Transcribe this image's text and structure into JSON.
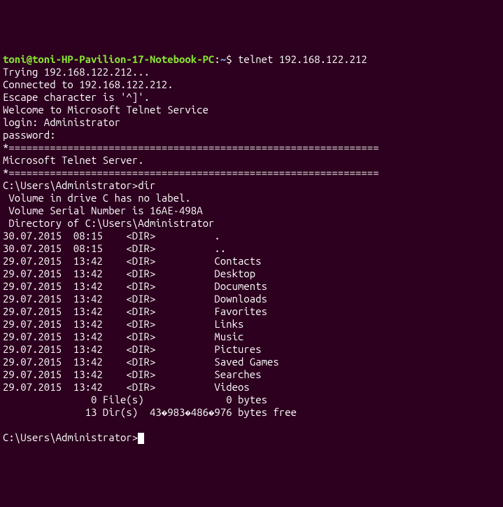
{
  "prompt": {
    "user_host": "toni@toni-HP-Pavilion-17-Notebook-PC",
    "colon": ":",
    "path": "~",
    "dollar": "$ ",
    "command": "telnet 192.168.122.212"
  },
  "output": {
    "l1": "Trying 192.168.122.212...",
    "l2": "Connected to 192.168.122.212.",
    "l3": "Escape character is '^]'.",
    "l4": "Welcome to Microsoft Telnet Service ",
    "l5": "",
    "l6": "login: Administrator",
    "l7": "password: ",
    "l8": "",
    "l9": "*===============================================================",
    "l10": "Microsoft Telnet Server.",
    "l11": "*===============================================================",
    "l12": "C:\\Users\\Administrator>dir",
    "l13": " Volume in drive C has no label.",
    "l14": " Volume Serial Number is 16AE-498A",
    "l15": "",
    "l16": " Directory of C:\\Users\\Administrator",
    "l17": ""
  },
  "dir_listing": [
    {
      "date": "30.07.2015",
      "time": "08:15",
      "type": "<DIR>",
      "name": "."
    },
    {
      "date": "30.07.2015",
      "time": "08:15",
      "type": "<DIR>",
      "name": ".."
    },
    {
      "date": "29.07.2015",
      "time": "13:42",
      "type": "<DIR>",
      "name": "Contacts"
    },
    {
      "date": "29.07.2015",
      "time": "13:42",
      "type": "<DIR>",
      "name": "Desktop"
    },
    {
      "date": "29.07.2015",
      "time": "13:42",
      "type": "<DIR>",
      "name": "Documents"
    },
    {
      "date": "29.07.2015",
      "time": "13:42",
      "type": "<DIR>",
      "name": "Downloads"
    },
    {
      "date": "29.07.2015",
      "time": "13:42",
      "type": "<DIR>",
      "name": "Favorites"
    },
    {
      "date": "29.07.2015",
      "time": "13:42",
      "type": "<DIR>",
      "name": "Links"
    },
    {
      "date": "29.07.2015",
      "time": "13:42",
      "type": "<DIR>",
      "name": "Music"
    },
    {
      "date": "29.07.2015",
      "time": "13:42",
      "type": "<DIR>",
      "name": "Pictures"
    },
    {
      "date": "29.07.2015",
      "time": "13:42",
      "type": "<DIR>",
      "name": "Saved Games"
    },
    {
      "date": "29.07.2015",
      "time": "13:42",
      "type": "<DIR>",
      "name": "Searches"
    },
    {
      "date": "29.07.2015",
      "time": "13:42",
      "type": "<DIR>",
      "name": "Videos"
    }
  ],
  "summary": {
    "files": "               0 File(s)              0 bytes",
    "dirs": "              13 Dir(s)  43�983�486�976 bytes free"
  },
  "final_prompt": {
    "text": "C:\\Users\\Administrator>"
  }
}
